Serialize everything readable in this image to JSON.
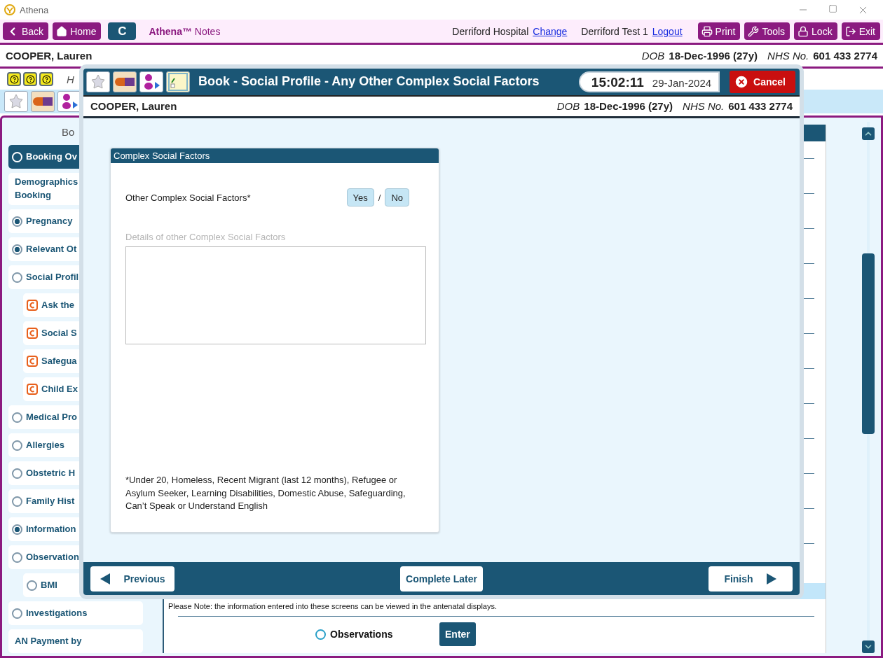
{
  "window": {
    "title": "Athena"
  },
  "toolbar": {
    "left_buttons": [
      {
        "label": "Back",
        "kind": "back"
      },
      {
        "label": "Home",
        "kind": "home"
      }
    ],
    "c_button": "C",
    "app_name": {
      "brand": "Athena™",
      "suffix": "Notes"
    },
    "hospital": "Derriford Hospital",
    "change_link": "Change",
    "user": "Derriford Test 1",
    "logout_link": "Logout",
    "right_buttons": [
      {
        "label": "Print",
        "kind": "print"
      },
      {
        "label": "Tools",
        "kind": "tools"
      },
      {
        "label": "Lock",
        "kind": "lock"
      },
      {
        "label": "Exit",
        "kind": "exit"
      }
    ]
  },
  "patient": {
    "name": "COOPER, Lauren",
    "dob_label": "DOB",
    "dob": "18-Dec-1996 (27y)",
    "nhs_label": "NHS No.",
    "nhs": "601 433 2774"
  },
  "help_row": {
    "text": "H"
  },
  "sidebar": {
    "heading": "Bo",
    "items": [
      {
        "kind": "radio",
        "label": "Booking Ov",
        "checked": false,
        "selected": true
      },
      {
        "kind": "text",
        "label": "Demographics\nBooking",
        "selected": false
      },
      {
        "kind": "radio",
        "label": "Pregnancy",
        "checked": true,
        "selected": false
      },
      {
        "kind": "radio",
        "label": "Relevant Ot",
        "checked": true,
        "selected": false
      },
      {
        "kind": "radio",
        "label": "Social Profil",
        "checked": false,
        "selected": false,
        "children": [
          {
            "kind": "flag",
            "label": "Ask the",
            "selected": false
          },
          {
            "kind": "flag",
            "label": "Social S",
            "selected": false
          },
          {
            "kind": "flag",
            "label": "Safegua",
            "selected": false
          },
          {
            "kind": "flag",
            "label": "Child Ex",
            "selected": false
          }
        ]
      },
      {
        "kind": "radio",
        "label": "Medical Pro",
        "checked": false,
        "selected": false
      },
      {
        "kind": "radio",
        "label": "Allergies",
        "checked": false,
        "selected": false
      },
      {
        "kind": "radio",
        "label": "Obstetric H",
        "checked": false,
        "selected": false
      },
      {
        "kind": "radio",
        "label": "Family Hist",
        "checked": false,
        "selected": false
      },
      {
        "kind": "radio",
        "label": "Information",
        "checked": true,
        "selected": false
      },
      {
        "kind": "radio",
        "label": "Observation",
        "checked": false,
        "selected": false,
        "children": [
          {
            "kind": "radio",
            "label": "BMI",
            "checked": false,
            "selected": false
          }
        ]
      },
      {
        "kind": "radio",
        "label": "Investigations",
        "checked": false,
        "selected": false
      },
      {
        "kind": "text",
        "label": "AN Payment by",
        "selected": false
      }
    ]
  },
  "content": {
    "note": "Please Note: the information entered into these screens can be viewed in the antenatal displays.",
    "rows": [
      {
        "label": "Observations",
        "checked": false,
        "button": "Enter"
      }
    ]
  },
  "dialog": {
    "title": "Book - Social Profile - Any Other Complex Social Factors",
    "time": "15:02:11",
    "date": "29-Jan-2024",
    "cancel": "Cancel",
    "patient": {
      "name": "COOPER, Lauren",
      "dob_label": "DOB",
      "dob": "18-Dec-1996 (27y)",
      "nhs_label": "NHS No.",
      "nhs": "601 433 2774"
    },
    "card": {
      "title": "Complex Social Factors",
      "question": "Other Complex Social Factors*",
      "options": [
        {
          "label": "Yes",
          "selected": false
        },
        {
          "label": "No",
          "selected": false
        }
      ],
      "separator": "/",
      "details_label": "Details of other Complex Social Factors",
      "footnote": "*Under 20, Homeless, Recent Migrant (last 12 months), Refugee or Asylum Seeker, Learning Disabilities, Domestic Abuse, Safeguarding, Can’t Speak or Understand English"
    },
    "footer": {
      "previous": "Previous",
      "later": "Complete Later",
      "finish": "Finish"
    }
  }
}
